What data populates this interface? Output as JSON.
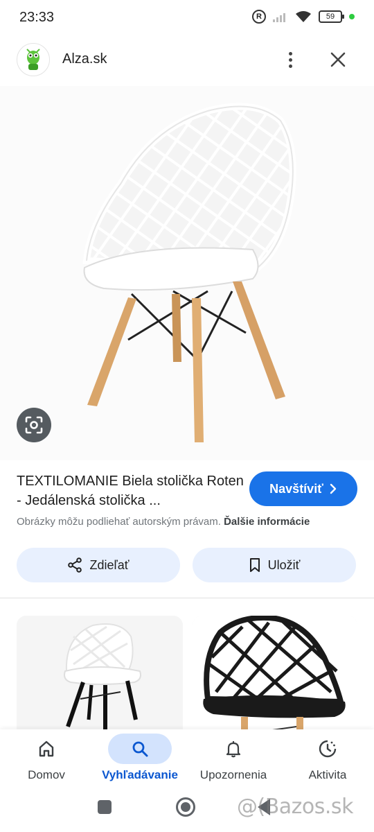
{
  "status_bar": {
    "time": "23:33",
    "registered_mark": "R",
    "battery": "59"
  },
  "header": {
    "site_name": "Alza.sk",
    "logo_icon": "alza-alien-icon",
    "more_icon": "more-vert-icon",
    "close_icon": "close-icon"
  },
  "hero": {
    "image": "white-lattice-chair-photo",
    "lens_icon": "google-lens-icon"
  },
  "result": {
    "title": "TEXTILOMANIE Biela stolička Roten - Jedálenská stolička ...",
    "visit_label": "Navštíviť",
    "copyright_text": "Obrázky môžu podliehať autorským právam.",
    "more_info_label": "Ďalšie informácie"
  },
  "actions": {
    "share_label": "Zdieľať",
    "save_label": "Uložiť"
  },
  "related": [
    {
      "image": "white-chair-black-legs-photo"
    },
    {
      "image": "black-lattice-chair-photo"
    }
  ],
  "bottom_nav": [
    {
      "label": "Domov",
      "icon": "home-icon",
      "active": false
    },
    {
      "label": "Vyhľadávanie",
      "icon": "search-icon",
      "active": true
    },
    {
      "label": "Upozornenia",
      "icon": "bell-icon",
      "active": false
    },
    {
      "label": "Aktivita",
      "icon": "activity-icon",
      "active": false
    }
  ],
  "watermark": "@(Bazos.sk",
  "colors": {
    "accent": "#1a73e8",
    "pill_bg": "#e8f0fe",
    "nav_active_bg": "#d3e3fd",
    "nav_active_text": "#0b57d0"
  }
}
